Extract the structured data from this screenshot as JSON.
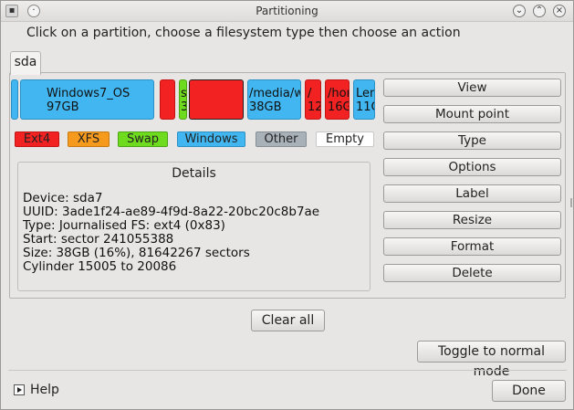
{
  "window": {
    "title": "Partitioning",
    "instruction": "Click on a partition, choose a filesystem type then choose an action"
  },
  "disk_tab": "sda",
  "partitions": [
    {
      "name": "",
      "size": "",
      "type": "windows"
    },
    {
      "name": "Windows7_OS",
      "size": "97GB",
      "type": "windows"
    },
    {
      "name": "",
      "size": "",
      "type": "ext4"
    },
    {
      "name": "s",
      "size": "3",
      "type": "swap"
    },
    {
      "name": "",
      "size": "",
      "type": "ext4"
    },
    {
      "name": "/media/w",
      "size": "38GB",
      "type": "windows"
    },
    {
      "name": "/",
      "size": "12",
      "type": "ext4"
    },
    {
      "name": "/hor",
      "size": "16G",
      "type": "ext4"
    },
    {
      "name": "Len",
      "size": "11C",
      "type": "windows"
    }
  ],
  "legend": [
    {
      "label": "Ext4",
      "color": "#f22222"
    },
    {
      "label": "XFS",
      "color": "#f69a1e"
    },
    {
      "label": "Swap",
      "color": "#6fdb1e"
    },
    {
      "label": "Windows",
      "color": "#41b6f0"
    },
    {
      "label": "Other",
      "color": "#a8b0b8"
    },
    {
      "label": "Empty",
      "color": "#ffffff"
    }
  ],
  "details": {
    "title": "Details",
    "lines": [
      "Device: sda7",
      "UUID: 3ade1f24-ae89-4f9d-8a22-20bc20c8b7ae",
      "Type: Journalised FS: ext4 (0x83)",
      "Start: sector 241055388",
      "Size: 38GB (16%), 81642267 sectors",
      "Cylinder 15005 to 20086"
    ]
  },
  "actions": [
    "View",
    "Mount point",
    "Type",
    "Options",
    "Label",
    "Resize",
    "Format",
    "Delete"
  ],
  "buttons": {
    "clear_all": "Clear all",
    "toggle_mode": "Toggle to normal mode",
    "help": "Help",
    "done": "Done"
  },
  "title_controls": {
    "menu": "menu-dot-icon",
    "minimize": "chevron-down-icon",
    "maximize": "chevron-up-icon",
    "close": "close-icon"
  }
}
